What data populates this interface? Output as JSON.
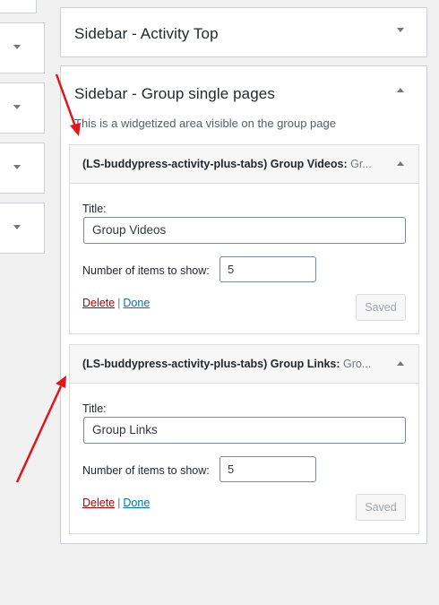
{
  "sidebars": {
    "activity_top": {
      "title": "Sidebar - Activity Top"
    },
    "group_single": {
      "title": "Sidebar - Group single pages",
      "description": "This is a widgetized area visible on the group page"
    }
  },
  "widgets": [
    {
      "head_title": "(LS-buddypress-activity-plus-tabs) Group Videos:",
      "head_sub": " Gr...",
      "title_label": "Title:",
      "title_value": "Group Videos",
      "items_label": "Number of items to show:",
      "items_value": "5",
      "delete_label": "Delete",
      "separator": "|",
      "done_label": "Done",
      "saved_label": "Saved"
    },
    {
      "head_title": "(LS-buddypress-activity-plus-tabs) Group Links:",
      "head_sub": " Gro...",
      "title_label": "Title:",
      "title_value": "Group Links",
      "items_label": "Number of items to show:",
      "items_value": "5",
      "delete_label": "Delete",
      "separator": "|",
      "done_label": "Done",
      "saved_label": "Saved"
    }
  ],
  "colors": {
    "annotation_arrow": "#e0161b",
    "delete_link": "#aa0000",
    "done_link": "#0073aa"
  },
  "icons": {
    "collapsed": "chevron-down-icon",
    "expanded": "chevron-up-icon"
  }
}
